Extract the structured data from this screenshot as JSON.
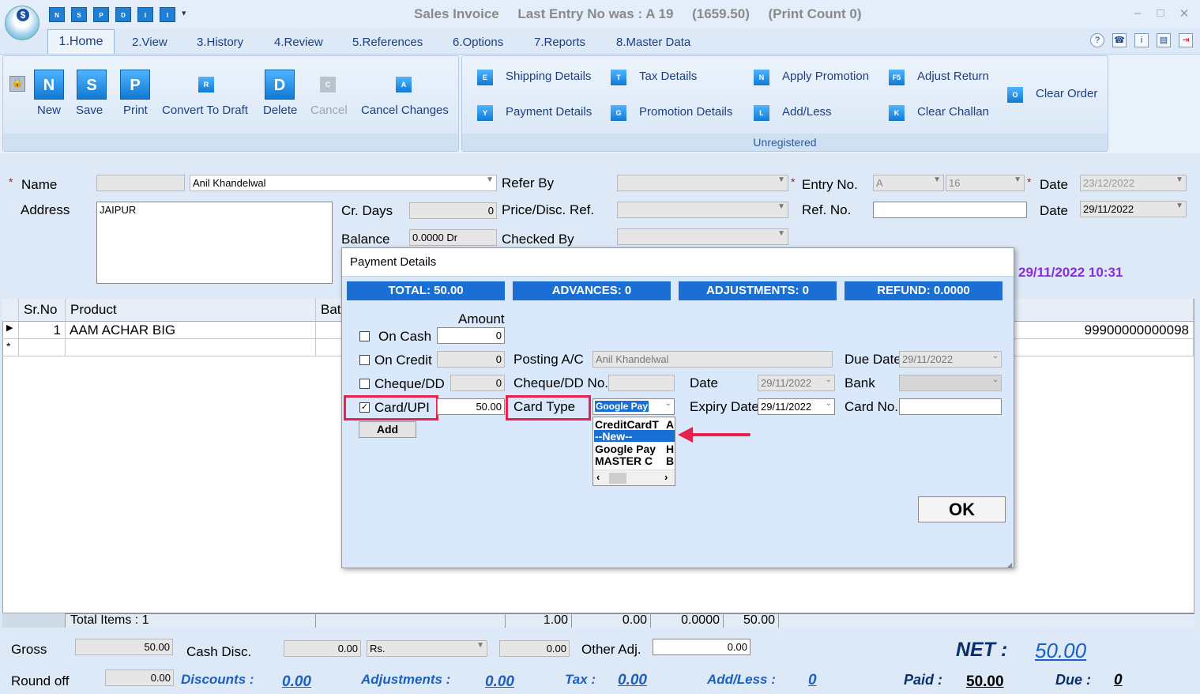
{
  "window": {
    "title": "Sales Invoice     Last Entry No was : A 19     (1659.50)     (Print Count 0)",
    "min": "‒",
    "max": "□",
    "close": "✕"
  },
  "quick_access": [
    "N",
    "S",
    "P",
    "D",
    "I",
    "I"
  ],
  "tabs": [
    "1.Home",
    "2.View",
    "3.History",
    "4.Review",
    "5.References",
    "6.Options",
    "7.Reports",
    "8.Master Data"
  ],
  "ribbon": {
    "buttons": [
      {
        "label": "New",
        "icon": "N"
      },
      {
        "label": "Save",
        "icon": "S"
      },
      {
        "label": "Print",
        "icon": "P"
      },
      {
        "label": "Convert To Draft",
        "icon": "R"
      },
      {
        "label": "Delete",
        "icon": "D"
      },
      {
        "label": "Cancel",
        "icon": "C"
      },
      {
        "label": "Cancel Changes",
        "icon": "A"
      }
    ],
    "links": [
      {
        "label": "Shipping Details",
        "icon": "E"
      },
      {
        "label": "Payment Details",
        "icon": "Y"
      },
      {
        "label": "Tax Details",
        "icon": "T"
      },
      {
        "label": "Promotion Details",
        "icon": "G"
      },
      {
        "label": "Apply Promotion",
        "icon": "N"
      },
      {
        "label": "Add/Less",
        "icon": "L"
      },
      {
        "label": "Adjust Return",
        "icon": "F5"
      },
      {
        "label": "Clear Challan",
        "icon": "K"
      },
      {
        "label": "Clear Order",
        "icon": "O"
      }
    ],
    "group2_footer": "Unregistered"
  },
  "form": {
    "name_label": "Name",
    "name_value": "Anil Khandelwal",
    "address_label": "Address",
    "address_value": "JAIPUR",
    "cr_days_label": "Cr. Days",
    "cr_days_value": "0",
    "balance_label": "Balance",
    "balance_value": "0.0000 Dr",
    "refer_by_label": "Refer By",
    "price_ref_label": "Price/Disc. Ref.",
    "checked_by_label": "Checked By",
    "entry_no_label": "Entry No.",
    "entry_series": "A",
    "entry_no": "16",
    "date_label": "Date",
    "date1": "23/12/2022",
    "ref_no_label": "Ref. No.",
    "date2": "29/11/2022",
    "timestamp": "29/11/2022 10:31"
  },
  "grid": {
    "headers": [
      "Sr.No",
      "Product",
      "Bat"
    ],
    "row": {
      "srno": "1",
      "product": "AAM ACHAR BIG",
      "barcode": "99900000000098"
    },
    "totals_label": "Total Items : 1",
    "totals": [
      "1.00",
      "0.00",
      "0.0000",
      "50.00"
    ]
  },
  "bottom": {
    "gross_label": "Gross",
    "gross": "50.00",
    "cash_disc_label": "Cash Disc.",
    "cash_disc": "0.00",
    "cash_disc_unit": "Rs.",
    "cash_disc2": "0.00",
    "other_adj_label": "Other Adj.",
    "other_adj": "0.00",
    "net_label": "NET :",
    "net": "50.00",
    "round_off_label": "Round off",
    "round_off": "0.00",
    "discounts_label": "Discounts :",
    "discounts": "0.00",
    "adjustments_label": "Adjustments :",
    "adjustments": "0.00",
    "tax_label": "Tax :",
    "tax": "0.00",
    "addless_label": "Add/Less :",
    "addless": "0",
    "paid_label": "Paid :",
    "paid": "50.00",
    "due_label": "Due :",
    "due": "0"
  },
  "dialog": {
    "title": "Payment Details",
    "total": "TOTAL: 50.00",
    "advances": "ADVANCES: 0",
    "adjustments": "ADJUSTMENTS: 0",
    "refund": "REFUND: 0.0000",
    "amount_header": "Amount",
    "on_cash": "On Cash",
    "on_cash_amt": "0",
    "on_credit": "On Credit",
    "on_credit_amt": "0",
    "cheque": "Cheque/DD",
    "cheque_amt": "0",
    "card": "Card/UPI",
    "card_amt": "50.00",
    "card_checked": "✓",
    "posting_label": "Posting A/C",
    "posting_value": "Anil Khandelwal",
    "due_date_label": "Due Date",
    "due_date_value": "29/11/2022",
    "cheque_no_label": "Cheque/DD No.",
    "date_label": "Date",
    "date_value": "29/11/2022",
    "bank_label": "Bank",
    "card_type_label": "Card Type",
    "card_type_value": "Google Pay",
    "expiry_label": "Expiry Date",
    "expiry_value": "29/11/2022",
    "card_no_label": "Card No.",
    "add": "Add",
    "ok": "OK",
    "list": [
      [
        "CreditCardT",
        "A"
      ],
      [
        "--New--",
        ""
      ],
      [
        "Google Pay",
        "H"
      ],
      [
        "MASTER C",
        "B"
      ]
    ]
  },
  "colors": {
    "accent": "#1a6fd4",
    "highlight": "#e8204e",
    "timestamp": "#8a2be2"
  }
}
